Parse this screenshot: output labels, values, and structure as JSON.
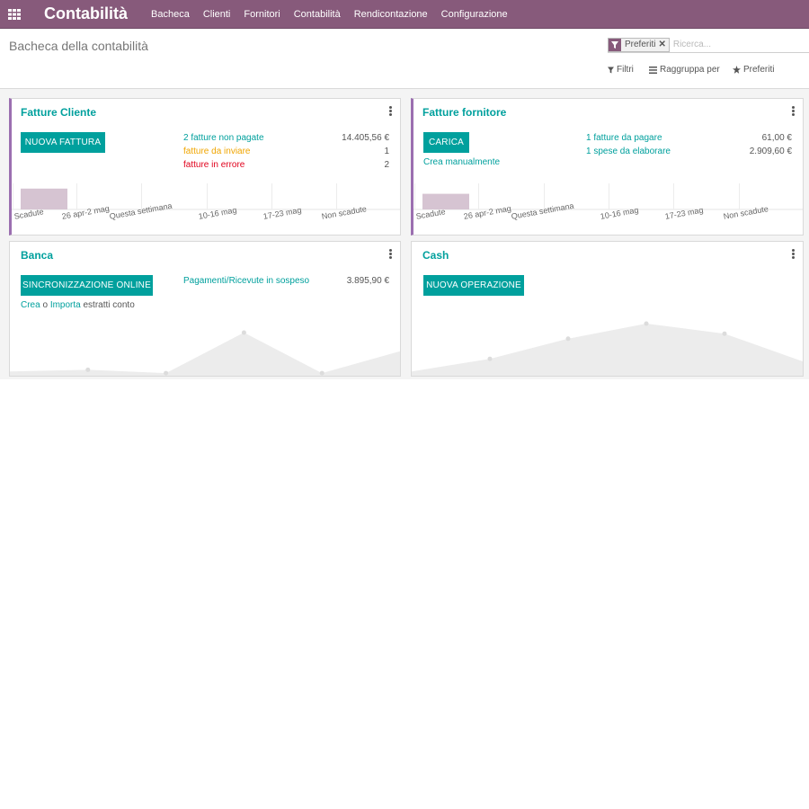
{
  "app": {
    "title": "Contabilità"
  },
  "menu": [
    "Bacheca",
    "Clienti",
    "Fornitori",
    "Contabilità",
    "Rendicontazione",
    "Configurazione"
  ],
  "control": {
    "page_title": "Bacheca della contabilità",
    "search": {
      "facet": "Preferiti",
      "placeholder": "Ricerca..."
    },
    "filters_label": "Filtri",
    "groupby_label": "Raggruppa per",
    "favorites_label": "Preferiti"
  },
  "cards": {
    "sales": {
      "title": "Fatture Cliente",
      "button": "NUOVA FATTURA",
      "stats": [
        {
          "label": "2 fatture non pagate",
          "value": "14.405,56 €",
          "color": "#00A09D"
        },
        {
          "label": "fatture da inviare",
          "value": "1",
          "color": "#f0a500"
        },
        {
          "label": "fatture in errore",
          "value": "2",
          "color": "#e0001b"
        }
      ]
    },
    "purchase": {
      "title": "Fatture fornitore",
      "button": "CARICA",
      "create_manually": "Crea manualmente",
      "stats": [
        {
          "label": "1 fatture da pagare",
          "value": "61,00 €",
          "color": "#00A09D"
        },
        {
          "label": "1 spese da elaborare",
          "value": "2.909,60 €",
          "color": "#00A09D"
        }
      ]
    },
    "bank": {
      "title": "Banca",
      "button": "SINCRONIZZAZIONE ONLINE",
      "stat": {
        "label": "Pagamenti/Ricevute in sospeso",
        "value": "3.895,90 €"
      },
      "sub_create": "Crea",
      "sub_or": "o",
      "sub_import": "Importa",
      "sub_rest": "estratti conto"
    },
    "cash": {
      "title": "Cash",
      "button": "NUOVA OPERAZIONE"
    }
  },
  "bar_chart": {
    "type": "bar",
    "categories": [
      "Scadute",
      "26 apr-2 mag",
      "Questa settimana",
      "10-16 mag",
      "17-23 mag",
      "Non scadute"
    ],
    "sales_values": [
      1,
      0,
      0,
      0,
      0,
      0
    ],
    "purchase_values": [
      0.75,
      0,
      0,
      0,
      0,
      0
    ],
    "ymax": 1,
    "bar_color": "#d6c4d2"
  },
  "line_chart": {
    "type": "area",
    "bank_values": [
      0.06,
      0.1,
      0.02,
      1,
      0.02,
      0.55
    ],
    "cash_values": [
      0.05,
      0.3,
      0.7,
      1,
      0.8,
      0.25
    ],
    "fill_color": "#ececec",
    "point_color": "#dcdcdc"
  },
  "colors": {
    "brand": "#875a7b",
    "accent": "#00A09D"
  }
}
